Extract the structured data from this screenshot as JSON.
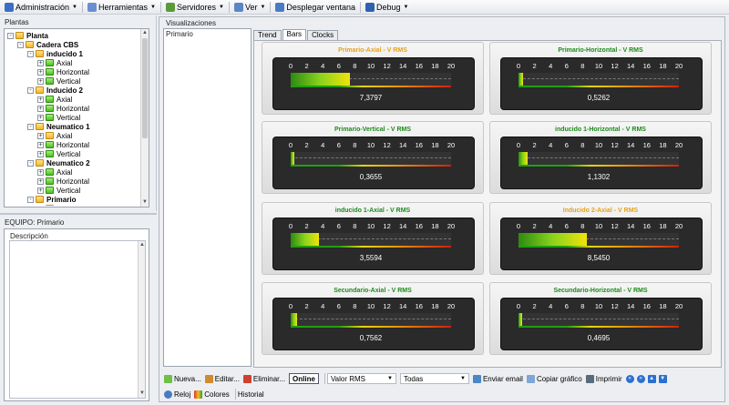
{
  "menu": [
    {
      "label": "Administración",
      "icon": "admin-icon",
      "color": "#3a6fc4"
    },
    {
      "label": "Herramientas",
      "icon": "tools-icon",
      "color": "#6a8fd0"
    },
    {
      "label": "Servidores",
      "icon": "server-icon",
      "color": "#5a9a3a"
    },
    {
      "label": "Ver",
      "icon": "view-icon",
      "color": "#5a86c4"
    },
    {
      "label": "Desplegar ventana",
      "icon": "window-icon",
      "color": "#4a7ac4"
    },
    {
      "label": "Debug",
      "icon": "debug-icon",
      "color": "#3060b0"
    }
  ],
  "left": {
    "plantas_title": "Plantas",
    "equipo_title": "EQUIPO: Primario",
    "descripcion_label": "Descripción"
  },
  "tree": [
    {
      "label": "Planta",
      "level": 0,
      "bold": true,
      "toggle": "-",
      "color": "yellow"
    },
    {
      "label": "Cadera CBS",
      "level": 1,
      "bold": true,
      "toggle": "-",
      "color": "yellow"
    },
    {
      "label": "inducido 1",
      "level": 2,
      "bold": true,
      "toggle": "-",
      "color": "yellow"
    },
    {
      "label": "Axial",
      "level": 3,
      "bold": false,
      "toggle": "+",
      "color": "green"
    },
    {
      "label": "Horizontal",
      "level": 3,
      "bold": false,
      "toggle": "+",
      "color": "green"
    },
    {
      "label": "Vertical",
      "level": 3,
      "bold": false,
      "toggle": "+",
      "color": "green"
    },
    {
      "label": "Inducido 2",
      "level": 2,
      "bold": true,
      "toggle": "-",
      "color": "yellow"
    },
    {
      "label": "Axial",
      "level": 3,
      "bold": false,
      "toggle": "+",
      "color": "green"
    },
    {
      "label": "Horizontal",
      "level": 3,
      "bold": false,
      "toggle": "+",
      "color": "green"
    },
    {
      "label": "Vertical",
      "level": 3,
      "bold": false,
      "toggle": "+",
      "color": "green"
    },
    {
      "label": "Neumatico 1",
      "level": 2,
      "bold": true,
      "toggle": "-",
      "color": "yellow"
    },
    {
      "label": "Axial",
      "level": 3,
      "bold": false,
      "toggle": "+",
      "color": "yellow"
    },
    {
      "label": "Horizontal",
      "level": 3,
      "bold": false,
      "toggle": "+",
      "color": "green"
    },
    {
      "label": "Vertical",
      "level": 3,
      "bold": false,
      "toggle": "+",
      "color": "green"
    },
    {
      "label": "Neumatico 2",
      "level": 2,
      "bold": true,
      "toggle": "-",
      "color": "yellow"
    },
    {
      "label": "Axial",
      "level": 3,
      "bold": false,
      "toggle": "+",
      "color": "green"
    },
    {
      "label": "Horizontal",
      "level": 3,
      "bold": false,
      "toggle": "+",
      "color": "green"
    },
    {
      "label": "Vertical",
      "level": 3,
      "bold": false,
      "toggle": "+",
      "color": "green"
    },
    {
      "label": "Primario",
      "level": 2,
      "bold": true,
      "toggle": "-",
      "color": "yellow"
    },
    {
      "label": "Axial",
      "level": 3,
      "bold": false,
      "toggle": "+",
      "color": "yellow"
    }
  ],
  "visualizaciones": {
    "title": "Visualizaciones",
    "list": [
      "Primario"
    ],
    "tabs": [
      "Trend",
      "Bars",
      "Clocks"
    ],
    "active_tab": "Bars"
  },
  "gauges": [
    {
      "title": "Primario-Axial - V RMS",
      "value": "7,3797",
      "fraction": 0.369,
      "title_color": "#e7a21a"
    },
    {
      "title": "Primario-Horizontal - V RMS",
      "value": "0,5262",
      "fraction": 0.026,
      "title_color": "#1e8a1e"
    },
    {
      "title": "Primario-Vertical - V RMS",
      "value": "0,3655",
      "fraction": 0.018,
      "title_color": "#1e8a1e"
    },
    {
      "title": "inducido 1-Horizontal - V RMS",
      "value": "1,1302",
      "fraction": 0.057,
      "title_color": "#1e8a1e"
    },
    {
      "title": "inducido 1-Axial - V RMS",
      "value": "3,5594",
      "fraction": 0.178,
      "title_color": "#1e8a1e"
    },
    {
      "title": "Inducido 2-Axial - V RMS",
      "value": "8,5450",
      "fraction": 0.427,
      "title_color": "#e7a21a"
    },
    {
      "title": "Secundario-Axial - V RMS",
      "value": "0,7562",
      "fraction": 0.038,
      "title_color": "#1e8a1e"
    },
    {
      "title": "Secundario-Horizontal - V RMS",
      "value": "0,4695",
      "fraction": 0.023,
      "title_color": "#1e8a1e"
    }
  ],
  "scale_ticks": [
    "0",
    "2",
    "4",
    "6",
    "8",
    "10",
    "12",
    "14",
    "16",
    "18",
    "20"
  ],
  "toolbar": {
    "nueva": "Nueva...",
    "editar": "Editar...",
    "eliminar": "Eliminar...",
    "online": "Online",
    "valor": "Valor RMS",
    "todas": "Todas",
    "enviar": "Enviar email",
    "copiar": "Copiar gráfico",
    "imprimir": "Imprimir"
  },
  "toolbar2": {
    "reloj": "Reloj",
    "colores": "Colores",
    "historial": "Historial"
  }
}
